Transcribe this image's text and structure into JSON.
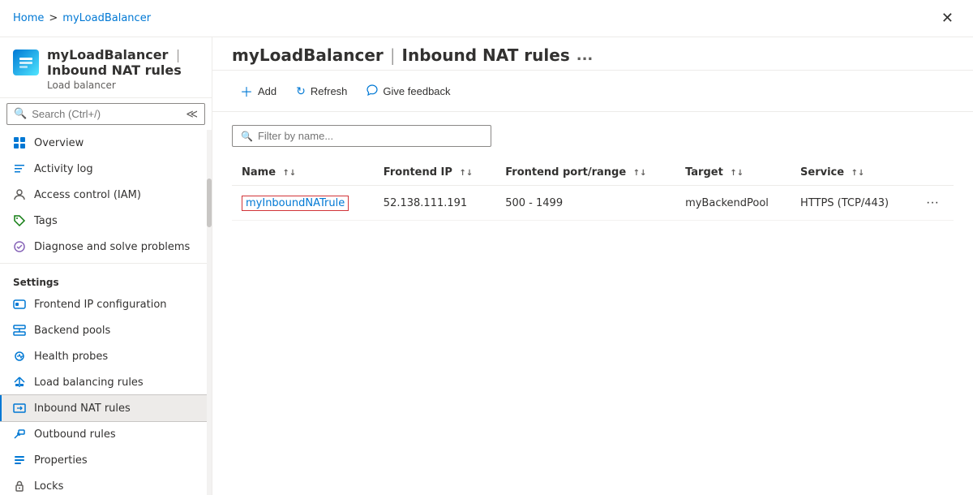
{
  "breadcrumb": {
    "home": "Home",
    "separator": ">",
    "current": "myLoadBalancer"
  },
  "resource": {
    "name": "myLoadBalancer",
    "separator": "|",
    "page": "Inbound NAT rules",
    "subtitle": "Load balancer",
    "more_icon": "..."
  },
  "search": {
    "placeholder": "Search (Ctrl+/)"
  },
  "toolbar": {
    "add_label": "Add",
    "refresh_label": "Refresh",
    "feedback_label": "Give feedback"
  },
  "filter": {
    "placeholder": "Filter by name..."
  },
  "table": {
    "columns": [
      {
        "label": "Name",
        "sort": "↑↓"
      },
      {
        "label": "Frontend IP",
        "sort": "↑↓"
      },
      {
        "label": "Frontend port/range",
        "sort": "↑↓"
      },
      {
        "label": "Target",
        "sort": "↑↓"
      },
      {
        "label": "Service",
        "sort": "↑↓"
      }
    ],
    "rows": [
      {
        "name": "myInboundNATrule",
        "frontend_ip": "52.138.111.191",
        "frontend_port_range": "500 - 1499",
        "target": "myBackendPool",
        "service": "HTTPS (TCP/443)"
      }
    ]
  },
  "sidebar": {
    "nav_items": [
      {
        "id": "overview",
        "label": "Overview",
        "icon": "overview"
      },
      {
        "id": "activity-log",
        "label": "Activity log",
        "icon": "activity"
      },
      {
        "id": "access-control",
        "label": "Access control (IAM)",
        "icon": "access"
      },
      {
        "id": "tags",
        "label": "Tags",
        "icon": "tags"
      },
      {
        "id": "diagnose",
        "label": "Diagnose and solve problems",
        "icon": "diagnose"
      }
    ],
    "settings_label": "Settings",
    "settings_items": [
      {
        "id": "frontend-ip",
        "label": "Frontend IP configuration",
        "icon": "frontend"
      },
      {
        "id": "backend-pools",
        "label": "Backend pools",
        "icon": "backend"
      },
      {
        "id": "health-probes",
        "label": "Health probes",
        "icon": "health"
      },
      {
        "id": "lb-rules",
        "label": "Load balancing rules",
        "icon": "lb"
      },
      {
        "id": "inbound-nat",
        "label": "Inbound NAT rules",
        "icon": "inbound",
        "active": true
      },
      {
        "id": "outbound-rules",
        "label": "Outbound rules",
        "icon": "outbound"
      },
      {
        "id": "properties",
        "label": "Properties",
        "icon": "properties"
      },
      {
        "id": "locks",
        "label": "Locks",
        "icon": "locks"
      }
    ]
  }
}
